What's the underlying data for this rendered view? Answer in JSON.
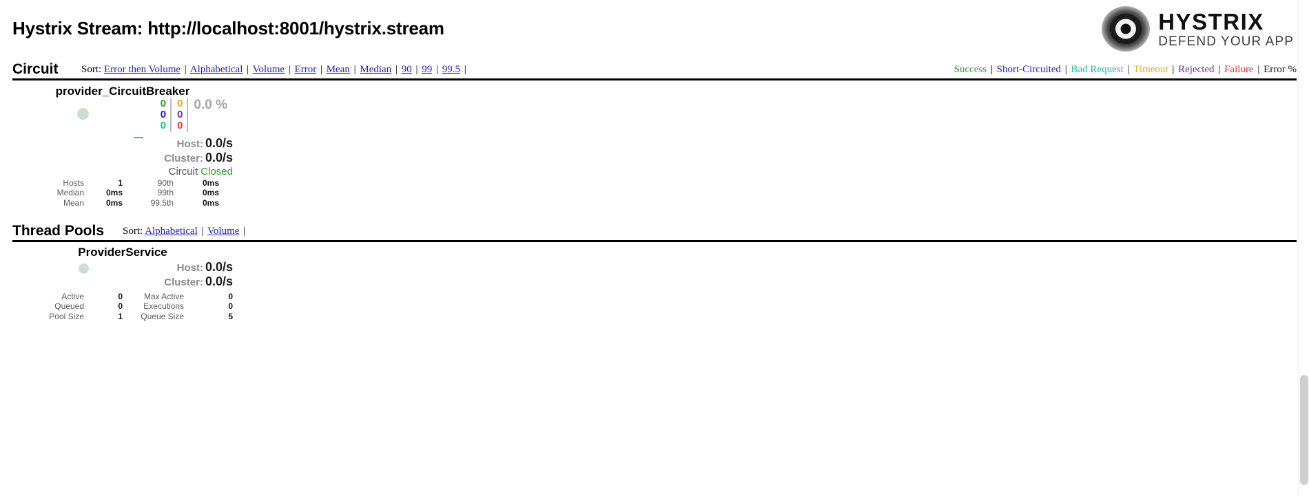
{
  "header": {
    "title": "Hystrix Stream: http://localhost:8001/hystrix.stream",
    "logo_line1": "HYSTRIX",
    "logo_line2": "DEFEND YOUR APP"
  },
  "circuit_section": {
    "title": "Circuit",
    "sort_label": "Sort:",
    "sort_links": [
      "Error then Volume",
      "Alphabetical",
      "Volume",
      "Error",
      "Mean",
      "Median",
      "90",
      "99",
      "99.5"
    ],
    "legend": [
      {
        "label": "Success",
        "color": "#2b9e2b"
      },
      {
        "label": "Short-Circuited",
        "color": "#1b1bd6"
      },
      {
        "label": "Bad Request",
        "color": "#16c39a"
      },
      {
        "label": "Timeout",
        "color": "#f6a417"
      },
      {
        "label": "Rejected",
        "color": "#7a28a8"
      },
      {
        "label": "Failure",
        "color": "#fa2a2a"
      },
      {
        "label": "Error %",
        "color": "#1a1a1a"
      }
    ]
  },
  "circuits": [
    {
      "name": "provider_CircuitBreaker",
      "counters": {
        "success": "0",
        "timeout": "0",
        "short_circuited": "0",
        "rejected": "0",
        "bad_request": "0",
        "failure": "0",
        "error_percent": "0.0 %"
      },
      "host_label": "Host:",
      "host_rate": "0.0/s",
      "cluster_label": "Cluster:",
      "cluster_rate": "0.0/s",
      "circuit_label": "Circuit",
      "circuit_state": "Closed",
      "stats": [
        {
          "l1": "Hosts",
          "v1": "1",
          "l2": "90th",
          "v2": "0ms"
        },
        {
          "l1": "Median",
          "v1": "0ms",
          "l2": "99th",
          "v2": "0ms"
        },
        {
          "l1": "Mean",
          "v1": "0ms",
          "l2": "99.5th",
          "v2": "0ms"
        }
      ]
    }
  ],
  "threadpool_section": {
    "title": "Thread Pools",
    "sort_label": "Sort:",
    "sort_links": [
      "Alphabetical",
      "Volume"
    ]
  },
  "threadpools": [
    {
      "name": "ProviderService",
      "host_label": "Host:",
      "host_rate": "0.0/s",
      "cluster_label": "Cluster:",
      "cluster_rate": "0.0/s",
      "stats": [
        {
          "l1": "Active",
          "v1": "0",
          "l2": "Max Active",
          "v2": "0"
        },
        {
          "l1": "Queued",
          "v1": "0",
          "l2": "Executions",
          "v2": "0"
        },
        {
          "l1": "Pool Size",
          "v1": "1",
          "l2": "Queue Size",
          "v2": "5"
        }
      ]
    }
  ]
}
